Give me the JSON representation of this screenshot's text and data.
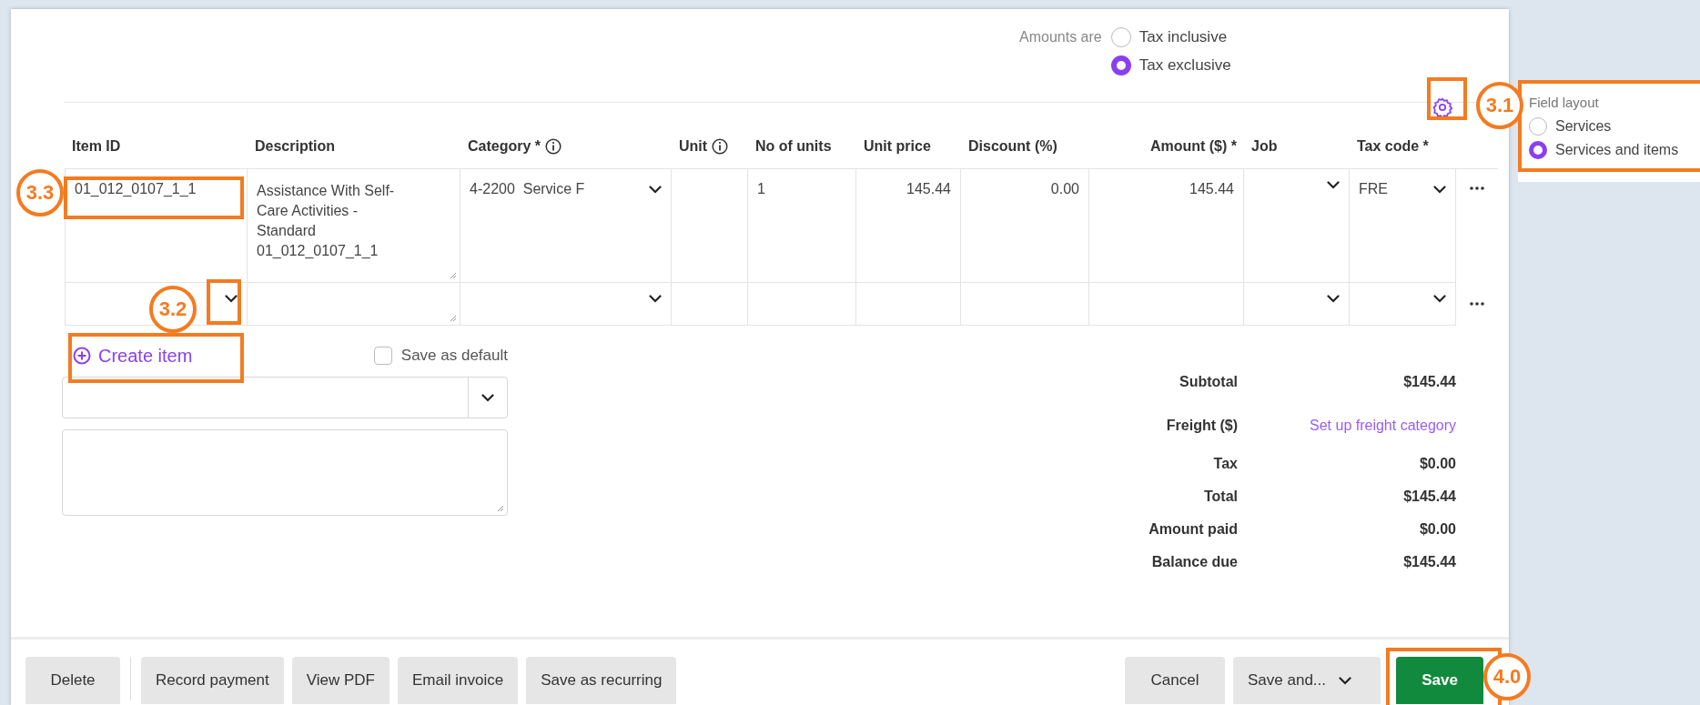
{
  "amounts": {
    "label": "Amounts are",
    "options": [
      {
        "label": "Tax inclusive",
        "selected": false
      },
      {
        "label": "Tax exclusive",
        "selected": true
      }
    ]
  },
  "field_layout": {
    "title": "Field layout",
    "options": [
      {
        "label": "Services",
        "selected": false
      },
      {
        "label": "Services and items",
        "selected": true
      }
    ]
  },
  "table": {
    "columns": [
      {
        "label": "Item ID",
        "info": false,
        "kind": "text"
      },
      {
        "label": "Description",
        "info": false,
        "kind": "text"
      },
      {
        "label": "Category *",
        "info": true,
        "kind": "text"
      },
      {
        "label": "Unit",
        "info": true,
        "kind": "text"
      },
      {
        "label": "No of units",
        "info": false,
        "kind": "text"
      },
      {
        "label": "Unit price",
        "info": false,
        "kind": "text"
      },
      {
        "label": "Discount (%)",
        "info": false,
        "kind": "text"
      },
      {
        "label": "Amount ($) *",
        "info": false,
        "kind": "amount"
      },
      {
        "label": "Job",
        "info": false,
        "kind": "text"
      },
      {
        "label": "Tax code *",
        "info": false,
        "kind": "text"
      }
    ],
    "rows": [
      {
        "cells": [
          {
            "kind": "input",
            "value": "01_012_0107_1_1"
          },
          {
            "kind": "textarea",
            "value": "Assistance With Self-Care Activities - Standard 01_012_0107_1_1"
          },
          {
            "kind": "select",
            "value": "4-2200  Service F"
          },
          {
            "kind": "input"
          },
          {
            "kind": "input",
            "value": "1"
          },
          {
            "kind": "number",
            "value": "145.44"
          },
          {
            "kind": "number",
            "value": "0.00"
          },
          {
            "kind": "number",
            "value": "145.44"
          },
          {
            "kind": "select"
          },
          {
            "kind": "select",
            "value": "FRE"
          }
        ]
      },
      {
        "cells": [
          {
            "kind": "select"
          },
          {
            "kind": "textarea"
          },
          {
            "kind": "select"
          },
          {
            "kind": "input"
          },
          {
            "kind": "input"
          },
          {
            "kind": "input"
          },
          {
            "kind": "input"
          },
          {
            "kind": "input"
          },
          {
            "kind": "select"
          },
          {
            "kind": "select"
          }
        ]
      }
    ]
  },
  "create_item": "Create item",
  "save_default": {
    "label": "Save as default",
    "checked": false
  },
  "totals": [
    {
      "label": "Subtotal",
      "value": "$145.44",
      "kind": "text"
    },
    {
      "label": "Freight ($)",
      "value": "Set up freight category",
      "kind": "link"
    },
    {
      "label": "Tax",
      "value": "$0.00",
      "kind": "text"
    },
    {
      "label": "Total",
      "value": "$145.44",
      "kind": "text"
    },
    {
      "label": "Amount paid",
      "value": "$0.00",
      "kind": "text"
    },
    {
      "label": "Balance due",
      "value": "$145.44",
      "kind": "text"
    }
  ],
  "footer_left": [
    {
      "label": "Delete",
      "kind": "default"
    },
    {
      "label": "Record payment",
      "kind": "default"
    },
    {
      "label": "View PDF",
      "kind": "default"
    },
    {
      "label": "Email invoice",
      "kind": "default"
    },
    {
      "label": "Save as recurring",
      "kind": "default"
    }
  ],
  "footer_right": [
    {
      "label": "Cancel",
      "kind": "default"
    },
    {
      "label": "Save and...",
      "kind": "menu"
    },
    {
      "label": "Save",
      "kind": "primary"
    }
  ],
  "annotations": [
    {
      "label": "3.1"
    },
    {
      "label": "3.2"
    },
    {
      "label": "3.3"
    },
    {
      "label": "4.0"
    }
  ]
}
